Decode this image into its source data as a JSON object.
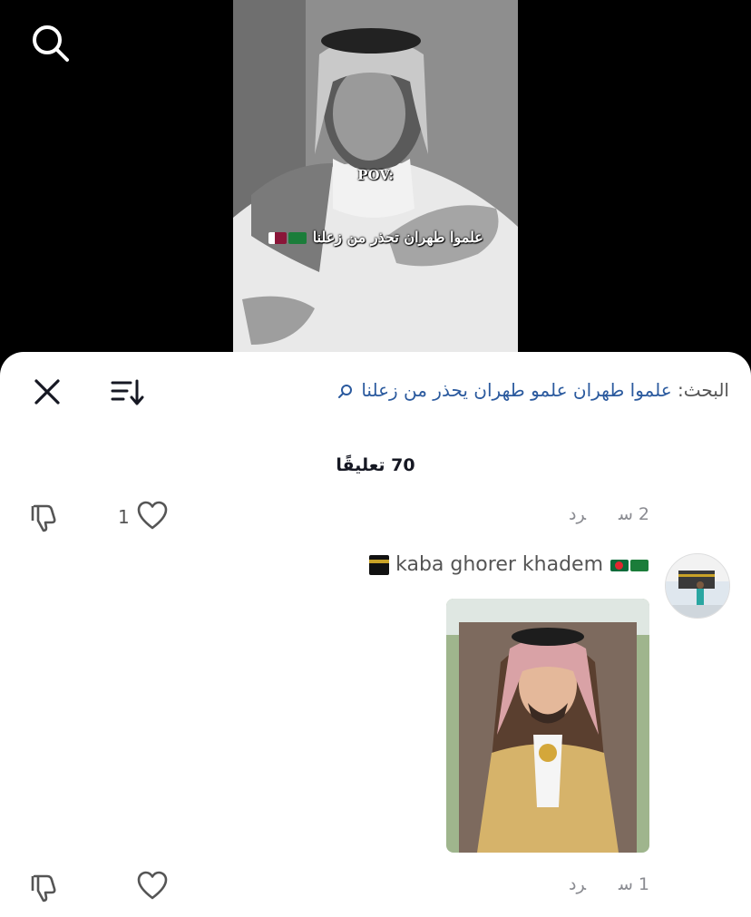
{
  "video": {
    "pov_text": "POV:",
    "caption_text": "علموا طهران تحذر من زعلنا",
    "caption_flags": [
      "saudi-flag",
      "qatar-flag"
    ],
    "search_icon": "search-icon"
  },
  "sheet": {
    "close_icon": "close-icon",
    "sort_icon": "sort-icon",
    "search_prefix": "البحث:",
    "search_query": "علموا طهران علمو طهران يحذر من زعلنا",
    "comment_count": "70 تعليقًا"
  },
  "comments": [
    {
      "time": "2 س",
      "reply_label": "رد",
      "like_count": "1"
    },
    {
      "username": "kaba ghorer khadem",
      "username_flags": [
        "saudi-flag",
        "bangladesh-flag"
      ],
      "username_emoji": "kaaba-emoji",
      "has_image": true,
      "time": "1 س",
      "reply_label": "رد",
      "like_count": ""
    }
  ],
  "colors": {
    "link_blue": "#2b5a9e",
    "meta_gray": "#8a8b91",
    "sheet_bg": "#ffffff"
  }
}
